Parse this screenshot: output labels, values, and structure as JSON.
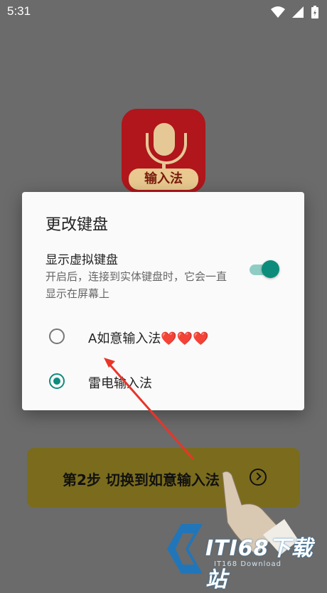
{
  "status_bar": {
    "time": "5:31"
  },
  "app_icon": {
    "badge_text": "输入法"
  },
  "dialog": {
    "title": "更改键盘",
    "toggle": {
      "title": "显示虚拟键盘",
      "description": "开启后，连接到实体键盘时，它会一直显示在屏幕上",
      "state": "on"
    },
    "options": [
      {
        "label": "A如意输入法❤️❤️❤️",
        "selected": false
      },
      {
        "label": "雷电输入法",
        "selected": true
      }
    ]
  },
  "step_button": {
    "label": "第2步  切换到如意输入法"
  },
  "watermark": {
    "text": "ITI68下载站",
    "sub": "IT168 Download"
  },
  "colors": {
    "accent": "#0d8c7c",
    "annotation_arrow": "#e8352a",
    "step_button_bg": "#7a6c1c"
  }
}
